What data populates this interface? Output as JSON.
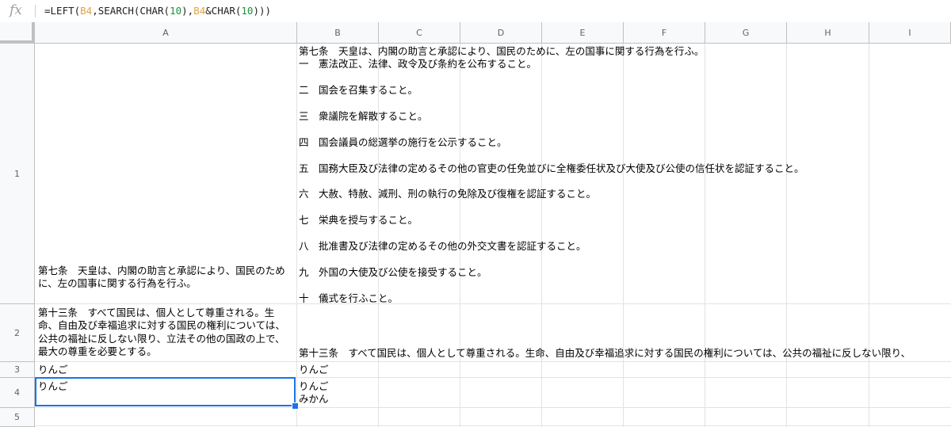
{
  "formula_bar": {
    "fx_label": "fx",
    "formula_parts": [
      {
        "text": "=LEFT(",
        "kind": "fn"
      },
      {
        "text": "B4",
        "kind": "ref"
      },
      {
        "text": ",SEARCH(CHAR(",
        "kind": "fn"
      },
      {
        "text": "10",
        "kind": "num"
      },
      {
        "text": "),",
        "kind": "fn"
      },
      {
        "text": "B4",
        "kind": "ref"
      },
      {
        "text": "&CHAR(",
        "kind": "fn"
      },
      {
        "text": "10",
        "kind": "num"
      },
      {
        "text": ")))",
        "kind": "fn"
      }
    ]
  },
  "columns": [
    "A",
    "B",
    "C",
    "D",
    "E",
    "F",
    "G",
    "H",
    "I"
  ],
  "rows": [
    "1",
    "2",
    "3",
    "4",
    "5"
  ],
  "cells": {
    "A1": "第七条　天皇は、内閣の助言と承認により、国民のために、左の国事に関する行為を行ふ。",
    "B1_lines": [
      "第七条　天皇は、内閣の助言と承認により、国民のために、左の国事に関する行為を行ふ。",
      "一　憲法改正、法律、政令及び条約を公布すること。",
      "",
      "二　国会を召集すること。",
      "",
      "三　衆議院を解散すること。",
      "",
      "四　国会議員の総選挙の施行を公示すること。",
      "",
      "五　国務大臣及び法律の定めるその他の官吏の任免並びに全権委任状及び大使及び公使の信任状を認証すること。",
      "",
      "六　大赦、特赦、減刑、刑の執行の免除及び復権を認証すること。",
      "",
      "七　栄典を授与すること。",
      "",
      "八　批准書及び法律の定めるその他の外交文書を認証すること。",
      "",
      "九　外国の大使及び公使を接受すること。",
      "",
      "十　儀式を行ふこと。"
    ],
    "A2": "第十三条　すべて国民は、個人として尊重される。生命、自由及び幸福追求に対する国民の権利については、公共の福祉に反しない限り、立法その他の国政の上で、最大の尊重を必要とする。",
    "B2": "第十三条　すべて国民は、個人として尊重される。生命、自由及び幸福追求に対する国民の権利については、公共の福祉に反しない限り、",
    "A3": "りんご",
    "B3": "りんご",
    "A4": "りんご",
    "B4_line1": "りんご",
    "B4_line2": "みかん"
  },
  "colors": {
    "selection": "#1a73e8",
    "header_bg": "#f8f9fa",
    "grid": "#e2e2e2",
    "ref": "#e6a23c",
    "number": "#1e8e3e"
  }
}
